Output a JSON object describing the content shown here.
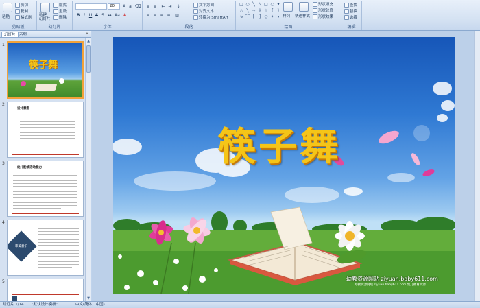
{
  "ribbon": {
    "clipboard": {
      "label": "剪贴板",
      "paste": "粘贴",
      "cut": "剪切",
      "copy": "复制",
      "format_painter": "格式刷"
    },
    "slides": {
      "label": "幻灯片",
      "new_slide": "新建\n幻灯片",
      "layout": "版式",
      "reset": "重设",
      "delete": "删除"
    },
    "font": {
      "label": "字体",
      "font_name": "",
      "font_size": "20"
    },
    "paragraph": {
      "label": "段落",
      "text_direction": "文字方向",
      "align_text": "对齐文本",
      "convert_smartart": "转换为 SmartArt"
    },
    "drawing": {
      "label": "绘图",
      "arrange": "排列",
      "quick_styles": "快速样式",
      "shape_fill": "形状填充",
      "shape_outline": "形状轮廓",
      "shape_effects": "形状效果"
    },
    "editing": {
      "label": "编辑",
      "find": "查找",
      "replace": "替换",
      "select": "选择"
    }
  },
  "panel": {
    "tab_slides": "幻灯片",
    "tab_outline": "大纲",
    "close": "×",
    "thumbnails": [
      {
        "num": "1",
        "title": "筷子舞"
      },
      {
        "num": "2",
        "title": "设计意图"
      },
      {
        "num": "3",
        "title": "幼儿能够活动能力"
      },
      {
        "num": "4",
        "title": "审美意识"
      },
      {
        "num": "5",
        "title": ""
      }
    ]
  },
  "slide": {
    "title": "筷子舞",
    "watermark": "幼教资源网站  ziyuan.baby611.com",
    "watermark_sub": "幼教资源网站 ziyuan.baby611.com 幼儿教育资源"
  },
  "status": {
    "slide_count": "幻灯片 1/14",
    "theme": "\"默认设计模板\"",
    "language": "中文(简体，中国)"
  },
  "colors": {
    "title": "#f5c518",
    "ribbon_bg": "#d6e3f3",
    "selected_border": "#f2a23a"
  }
}
